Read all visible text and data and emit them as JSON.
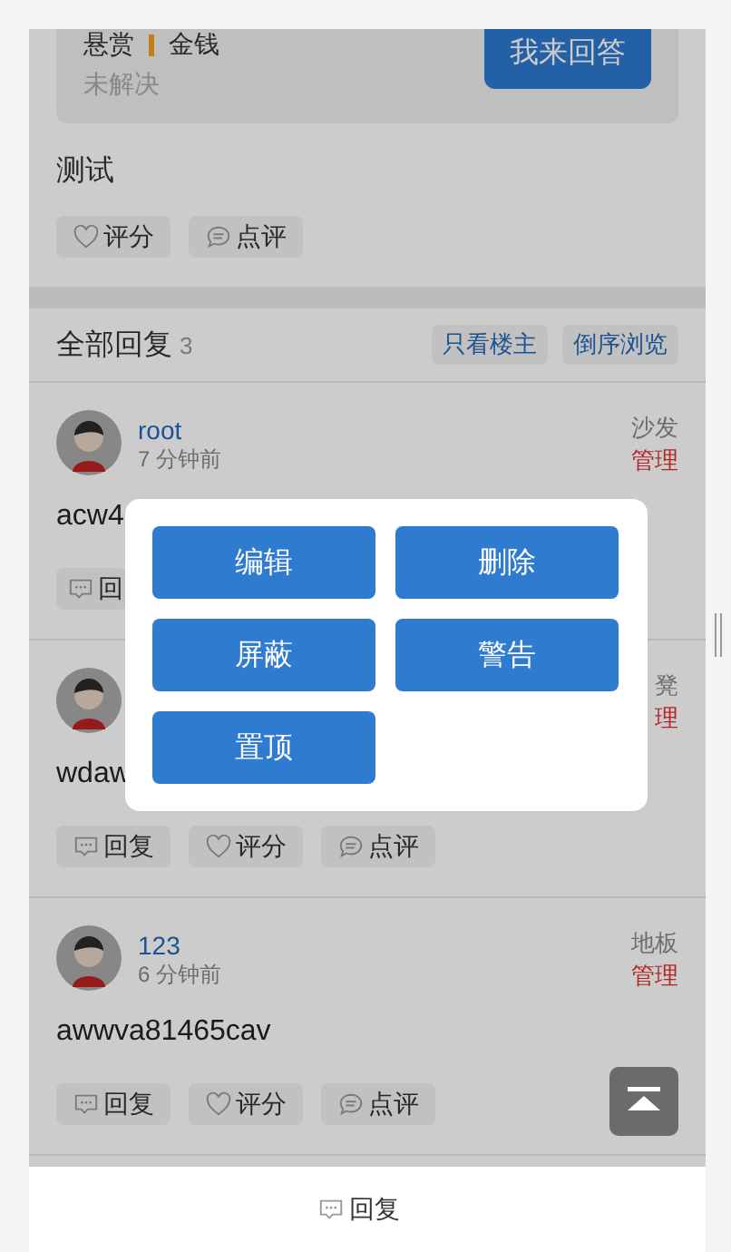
{
  "reward_card": {
    "labels": [
      "悬赏",
      "金钱"
    ],
    "status": "未解决",
    "answer_button": "我来回答"
  },
  "thread": {
    "content": "测试",
    "actions": [
      {
        "kind": "rate",
        "label": "评分"
      },
      {
        "kind": "comment",
        "label": "点评"
      }
    ]
  },
  "replies_header": {
    "title": "全部回复",
    "count": "3",
    "buttons": [
      "只看楼主",
      "倒序浏览"
    ]
  },
  "posts": [
    {
      "author": "root",
      "time": "7 分钟前",
      "floor": "沙发",
      "manage": "管理",
      "content": "acw4",
      "actions": [
        {
          "kind": "reply",
          "label": "回"
        }
      ]
    },
    {
      "floor": "凳",
      "manage": "理",
      "content": "wdaw",
      "actions": [
        {
          "kind": "reply",
          "label": "回复"
        },
        {
          "kind": "rate",
          "label": "评分"
        },
        {
          "kind": "comment",
          "label": "点评"
        }
      ]
    },
    {
      "author": "123",
      "time": "6 分钟前",
      "floor": "地板",
      "manage": "管理",
      "content": "awwva81465cav",
      "actions": [
        {
          "kind": "reply",
          "label": "回复"
        },
        {
          "kind": "rate",
          "label": "评分"
        },
        {
          "kind": "comment",
          "label": "点评"
        }
      ]
    }
  ],
  "dialog": {
    "buttons": [
      "编辑",
      "删除",
      "屏蔽",
      "警告",
      "置顶"
    ]
  },
  "bottom_bar": {
    "reply": "回复"
  }
}
